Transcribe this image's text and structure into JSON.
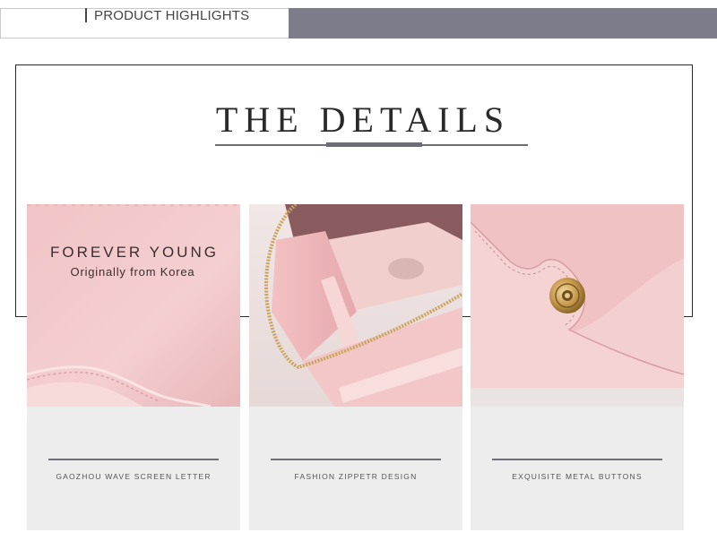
{
  "header": {
    "title": "PRODUCT HIGHLIGHTS"
  },
  "section": {
    "title": "THE DETAILS"
  },
  "cards": [
    {
      "photo_text_1": "FOREVER YOUNG",
      "photo_text_2": "Originally from Korea",
      "caption": "GAOZHOU WAVE SCREEN LETTER"
    },
    {
      "caption": "FASHION ZIPPETR DESIGN"
    },
    {
      "caption": "EXQUISITE METAL BUTTONS"
    }
  ],
  "colors": {
    "banner": "#7d7c8b",
    "leather_pink": "#f2c6c8",
    "card_bg": "#ededed"
  }
}
